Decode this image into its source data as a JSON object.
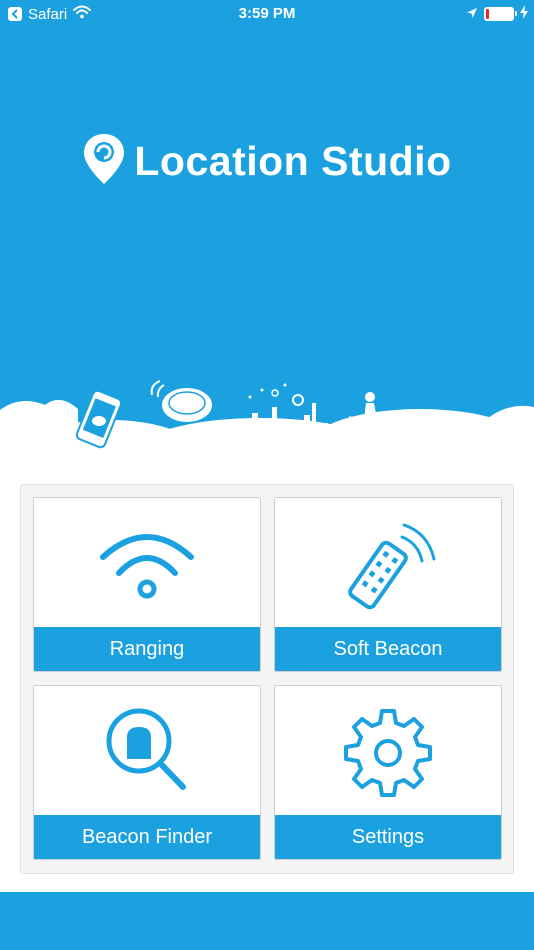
{
  "status_bar": {
    "back_app": "Safari",
    "time": "3:59 PM",
    "battery_level": 0.1
  },
  "app": {
    "title": "Location Studio"
  },
  "tiles": [
    {
      "label": "Ranging",
      "icon": "wifi-icon"
    },
    {
      "label": "Soft Beacon",
      "icon": "remote-beacon-icon"
    },
    {
      "label": "Beacon Finder",
      "icon": "magnifier-icon"
    },
    {
      "label": "Settings",
      "icon": "gear-icon"
    }
  ],
  "colors": {
    "brand": "#1ba1e0",
    "battery_low": "#e8262b",
    "background": "#ffffff"
  }
}
